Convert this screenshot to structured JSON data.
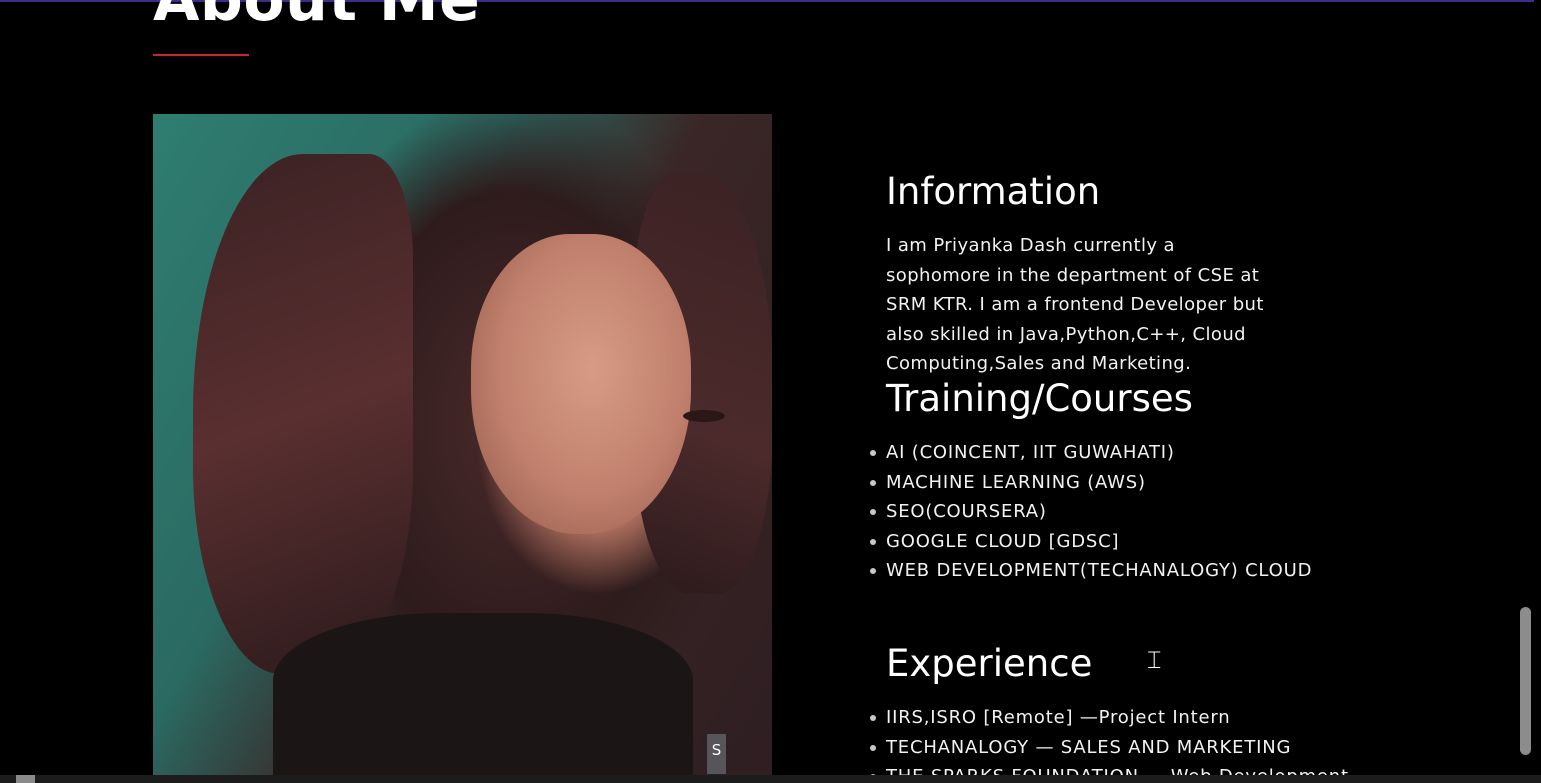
{
  "section": {
    "title": "About Me",
    "underline_color": "#cc2431"
  },
  "photo": {
    "tooltip_text": "S"
  },
  "information": {
    "heading": "Information",
    "text": "I am Priyanka Dash currently a sophomore in the department of CSE at SRM KTR. I am a frontend Developer but also skilled in Java,Python,C++, Cloud Computing,Sales and Marketing."
  },
  "training": {
    "heading": "Training/Courses",
    "items": [
      "AI (COINCENT, IIT GUWAHATI)",
      "MACHINE LEARNING (AWS)",
      "SEO(COURSERA)",
      "GOOGLE CLOUD [GDSC]",
      "WEB DEVELOPMENT(TECHANALOGY) CLOUD"
    ]
  },
  "experience": {
    "heading": "Experience",
    "items": [
      "IIRS,ISRO [Remote] —Project Intern",
      "TECHANALOGY — SALES AND MARKETING",
      "THE SPARKS FOUNDATION — Web Development"
    ]
  },
  "colors": {
    "background": "#000000",
    "text": "#ffffff",
    "accent": "#cc2431",
    "top_bar": "#3b2e8c"
  },
  "icons": {
    "cursor": "text-cursor-icon"
  }
}
